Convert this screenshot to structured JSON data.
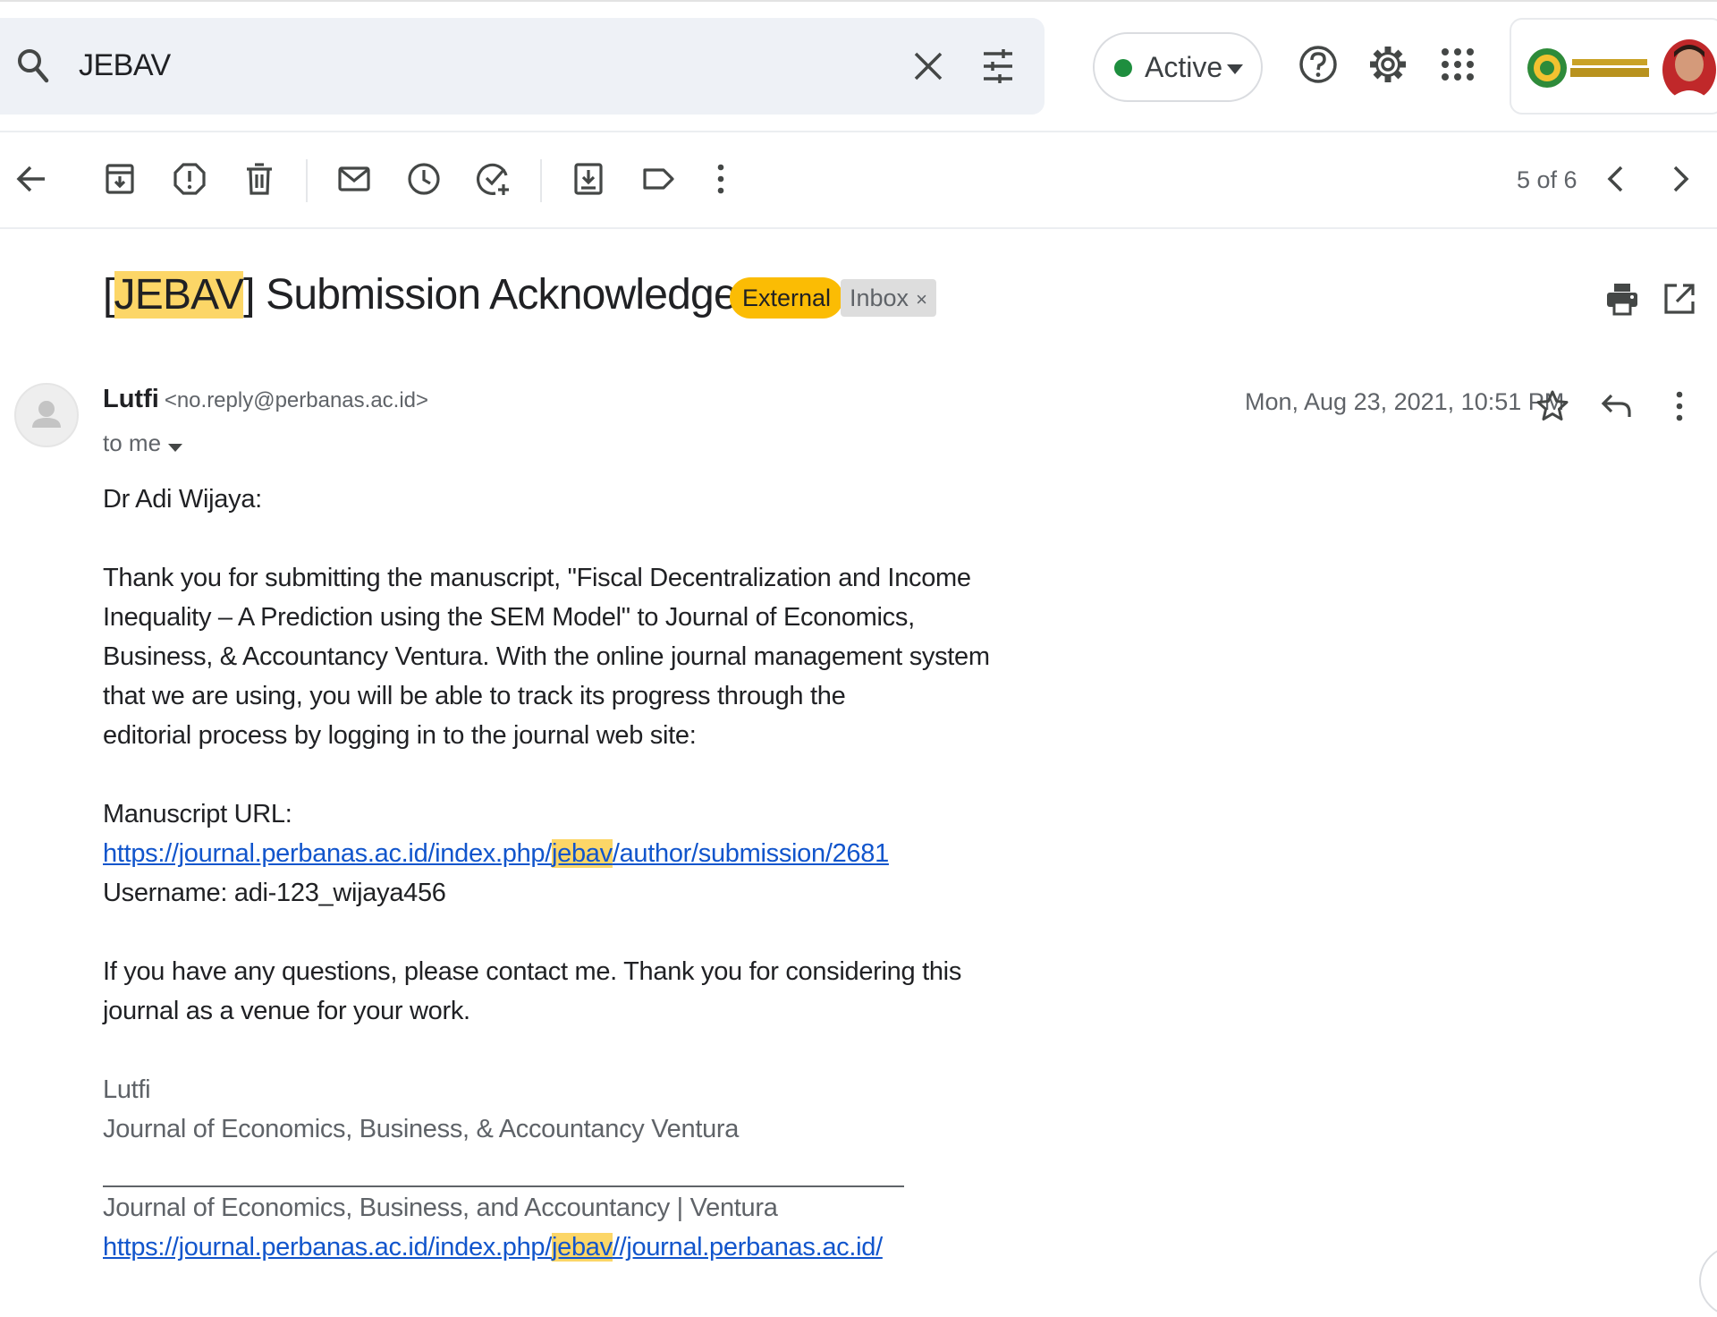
{
  "search": {
    "query": "JEBAV"
  },
  "status": {
    "label": "Active",
    "color": "#1e8e3e"
  },
  "toolbar": {
    "pager": "5 of 6"
  },
  "subject": {
    "prefix": "[",
    "highlight": "JEBAV",
    "rest": "] Submission Acknowledgement",
    "labels": {
      "external": "External",
      "inbox": "Inbox",
      "inbox_remove": "×"
    }
  },
  "message": {
    "sender_name": "Lutfi",
    "sender_email": "<no.reply@perbanas.ac.id>",
    "recipient": "to me",
    "date": "Mon, Aug 23, 2021, 10:51 PM"
  },
  "body": {
    "greeting": "Dr Adi Wijaya:",
    "p1": [
      "Thank you for submitting the manuscript, \"Fiscal Decentralization and Income",
      "Inequality – A Prediction using the SEM Model\" to Journal of Economics,",
      "Business, & Accountancy Ventura. With the online journal management system",
      "that we are using, you will be able to track its progress through the",
      "editorial process by logging in to the journal web site:"
    ],
    "manuscript_label": "Manuscript URL:",
    "manuscript_url": {
      "pre": "https://journal.perbanas.ac.id/index.php/",
      "highlight": "jebav",
      "post": "/author/submission/2681"
    },
    "username": "Username: adi-123_wijaya456",
    "p2": [
      "If you have any questions, please contact me. Thank you for considering this",
      "journal as a venue for your work."
    ],
    "signature": {
      "name": "Lutfi",
      "journal": "Journal of Economics, Business, & Accountancy Ventura"
    },
    "footer": {
      "journal": "Journal of Economics, Business, and Accountancy | Ventura",
      "url": {
        "pre": "https://journal.perbanas.ac.id/index.php/",
        "highlight": "jebav",
        "post": "//journal.perbanas.ac.id/"
      }
    }
  },
  "colors": {
    "highlight": "#fcd667",
    "external_badge": "#fbbc04",
    "link": "#1155cc"
  }
}
